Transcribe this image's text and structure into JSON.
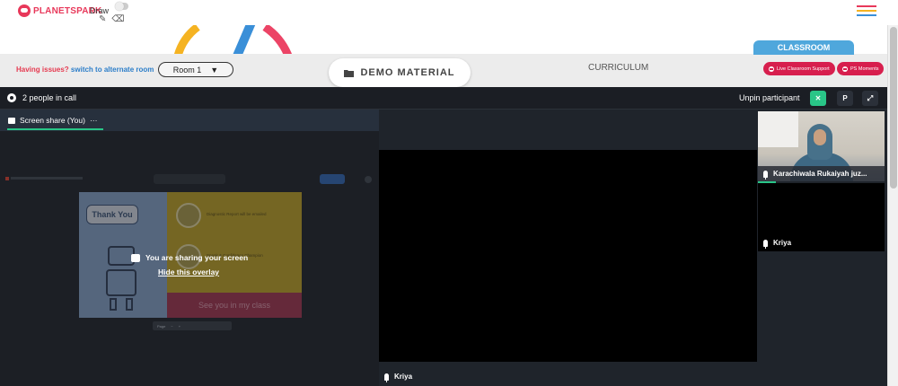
{
  "brand": {
    "logo_text": "PLANETSPARK"
  },
  "draw": {
    "label": "Draw",
    "pen": "pencil-icon",
    "eraser": "eraser-icon"
  },
  "toolbar": {
    "issues_text": "Having issues?",
    "alternate_link": "switch to alternate room",
    "room_value": "Room 1",
    "demo_material": "DEMO MATERIAL",
    "curriculum": "CURRICULUM",
    "classroom": "CLASSROOM",
    "live_support": "Live Classroom Support",
    "ps_moments": "PS Moments"
  },
  "call": {
    "people_count": "2 people in call",
    "unpin": "Unpin participant",
    "pin_initial": "P",
    "screen_share_tab": "Screen share (You)",
    "overlay_message": "You are sharing your screen",
    "hide_overlay": "Hide this overlay",
    "center_participant": "Kriya",
    "participants": [
      {
        "name": "Karachiwala Rukaiyah juz..."
      },
      {
        "name": "Kriya"
      }
    ]
  },
  "shared_slide": {
    "thank_you": "Thank You",
    "see_you": "See you in my class",
    "line1": "Diagnostic Report will be emailed",
    "line2": "Speak & Confidence Champion",
    "page_label": "Page"
  },
  "colors": {
    "brand_red": "#e8385a",
    "accent_green": "#29c587",
    "classroom_blue": "#4fa7dc",
    "pill_red": "#d71f4e"
  }
}
